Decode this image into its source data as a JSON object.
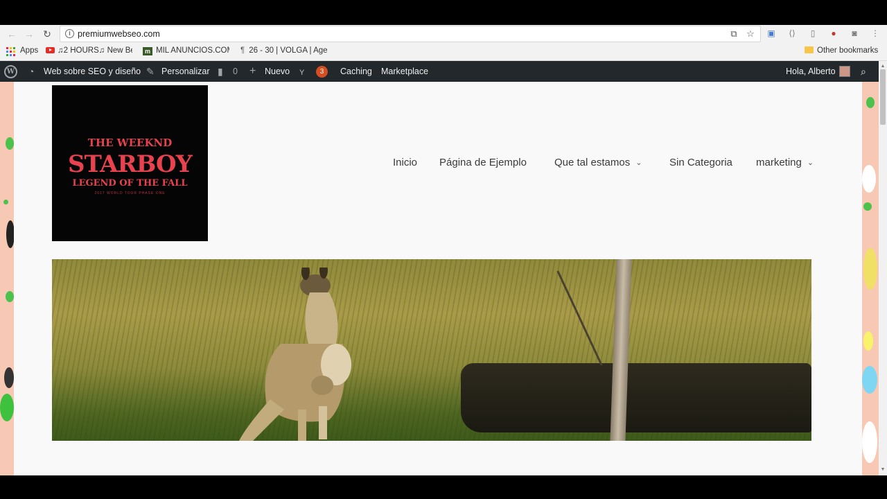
{
  "browser": {
    "url": "premiumwebseo.com",
    "bookmarks": [
      {
        "label": "Apps"
      },
      {
        "label": "♫2 HOURS♫ New Be"
      },
      {
        "label": "MIL ANUNCIOS.COM"
      },
      {
        "label": "26 - 30 | VOLGA | Age"
      }
    ],
    "other_bookmarks": "Other bookmarks"
  },
  "admin_bar": {
    "site_name": "Web sobre SEO y diseño",
    "customize": "Personalizar",
    "comments_count": "0",
    "new": "Nuevo",
    "yoast_badge": "3",
    "caching": "Caching",
    "marketplace": "Marketplace",
    "greeting": "Hola, Alberto"
  },
  "logo": {
    "line1": "THE WEEKND",
    "line2": "STARBOY",
    "line3": "LEGEND OF THE FALL",
    "line4": "2017 WORLD TOUR PHASE ONE",
    "accent_color": "#e8424f"
  },
  "menu": [
    {
      "label": "Inicio",
      "has_submenu": false
    },
    {
      "label": "Página de Ejemplo",
      "has_submenu": false
    },
    {
      "label": "Que tal estamos",
      "has_submenu": true
    },
    {
      "label": "Sin Categoria",
      "has_submenu": false
    },
    {
      "label": "marketing",
      "has_submenu": true
    }
  ],
  "icons": {
    "chevron": "⌄"
  }
}
